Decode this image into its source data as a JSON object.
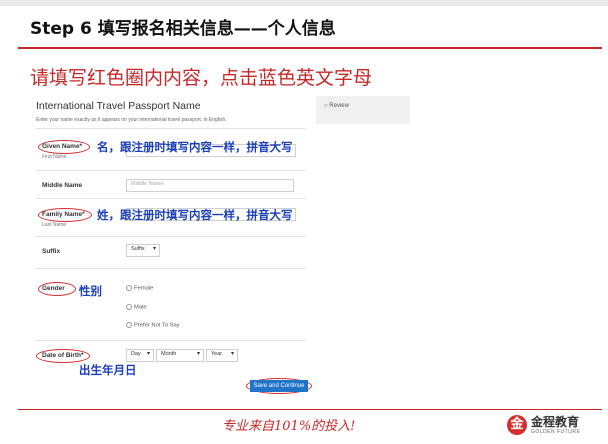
{
  "slide": {
    "title": "Step 6 填写报名相关信息——个人信息",
    "instruction": "请填写红色圈内内容，点击蓝色英文字母"
  },
  "form": {
    "title": "International Travel Passport Name",
    "subtitle": "Enter your name exactly as it appears on your international travel passport, in English.",
    "given_name_label": "Given Name*",
    "given_name_sub": "First Name",
    "middle_name_label": "Middle Name",
    "middle_name_placeholder": "Middle Name",
    "family_name_label": "Family Name*",
    "family_name_sub": "Last Name",
    "suffix_label": "Suffix",
    "suffix_value": "Suffix",
    "gender_label": "Gender",
    "gender_options": [
      "Female",
      "Male",
      "Prefer Not To Say"
    ],
    "dob_label": "Date of Birth*",
    "dob_day": "Day",
    "dob_month": "Month",
    "dob_year": "Year",
    "submit_label": "Save and Continue"
  },
  "sidebar": {
    "review_label": "Review"
  },
  "annotations": {
    "given": "名，跟注册时填写内容一样，拼音大写",
    "family": "姓，跟注册时填写内容一样，拼音大写",
    "gender": "性别",
    "dob": "出生年月日"
  },
  "footer": {
    "slogan": "专业来自101%的投入!",
    "brand": "金程教育",
    "brand_en": "GOLDEN FUTURE"
  },
  "icons": {
    "dropdown": "chevron-down-icon",
    "logo": "brand-logo-icon"
  },
  "colors": {
    "accent_red": "#c62828",
    "note_blue": "#1a3fb8",
    "button_blue": "#1f73c9"
  }
}
